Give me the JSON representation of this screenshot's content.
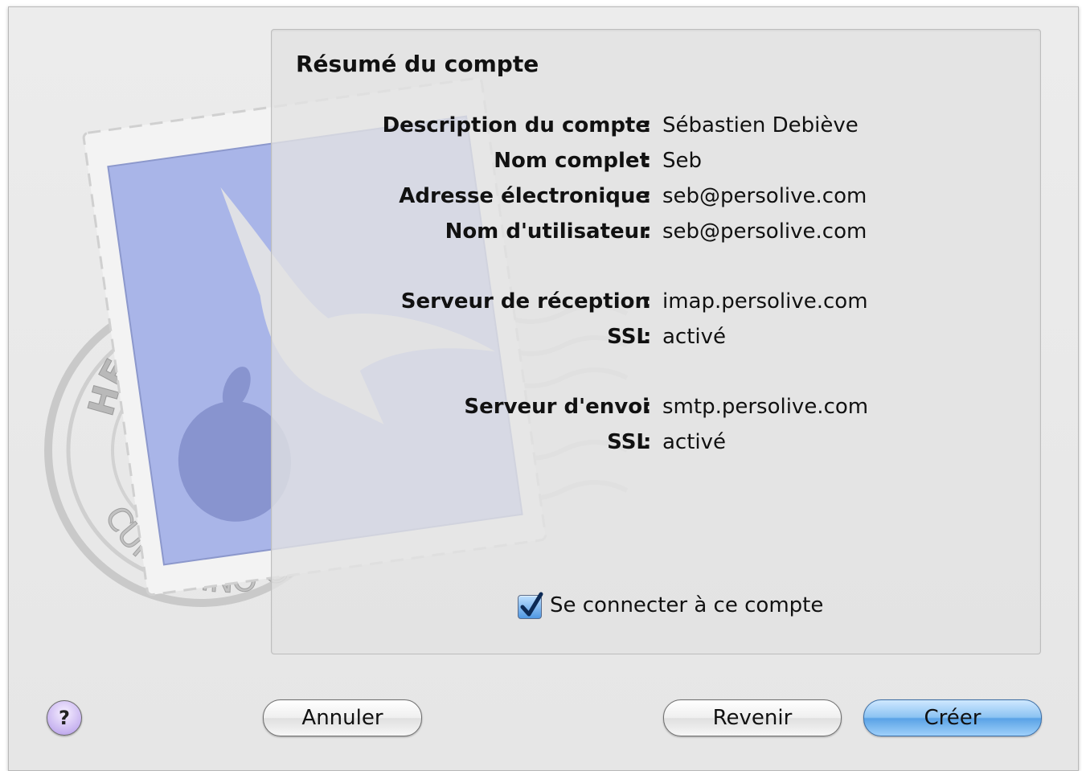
{
  "panel": {
    "title": "Résumé du compte"
  },
  "summary": {
    "rows": [
      {
        "label": "Description du compte",
        "value": "Sébastien Debiève"
      },
      {
        "label": "Nom complet",
        "value": "Seb"
      },
      {
        "label": "Adresse électronique",
        "value": "seb@persolive.com"
      },
      {
        "label": "Nom d'utilisateur",
        "value": "seb@persolive.com"
      },
      {
        "label": "Serveur de réception",
        "value": "imap.persolive.com"
      },
      {
        "label": "SSL",
        "value": "activé"
      },
      {
        "label": "Serveur d'envoi",
        "value": "smtp.persolive.com"
      },
      {
        "label": "SSL",
        "value": "activé"
      }
    ],
    "separator": ":"
  },
  "connect": {
    "label": "Se connecter à ce compte",
    "checked": true
  },
  "buttons": {
    "help": "?",
    "cancel": "Annuler",
    "back": "Revenir",
    "create": "Créer"
  },
  "illustration": {
    "stamp_text_top": "HELLO FR",
    "stamp_text_bottom": "CUPERTINO CA"
  },
  "colors": {
    "stamp_blue": "#a9b5e8",
    "primary_button": "#5aa3e6",
    "checkbox": "#4f97e3"
  }
}
